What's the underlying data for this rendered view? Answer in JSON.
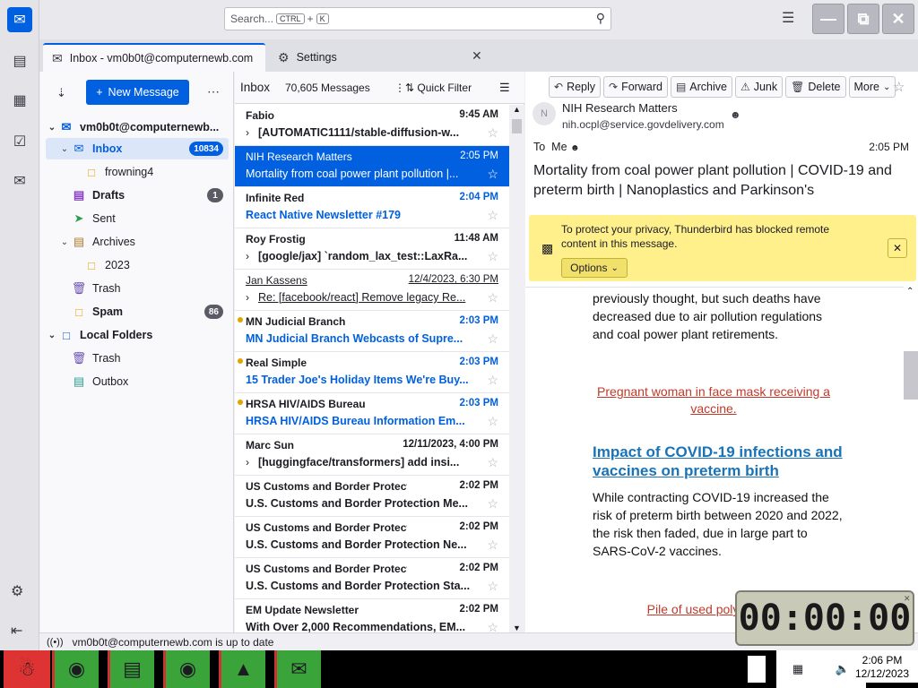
{
  "search": {
    "placeholder": "Search...",
    "key1": "CTRL",
    "plus": "+",
    "key2": "K"
  },
  "tabs": [
    {
      "label": "Inbox - vm0b0t@computernewb.com"
    },
    {
      "label": "Settings"
    }
  ],
  "folder_pane": {
    "new_message": "New Message",
    "folders": [
      {
        "label": "vm0b0t@computernewb...",
        "bold": true
      },
      {
        "label": "Inbox",
        "badge": "10834"
      },
      {
        "label": "frowning4"
      },
      {
        "label": "Drafts",
        "badge": "1"
      },
      {
        "label": "Sent"
      },
      {
        "label": "Archives"
      },
      {
        "label": "2023"
      },
      {
        "label": "Trash"
      },
      {
        "label": "Spam",
        "badge": "86"
      },
      {
        "label": "Local Folders"
      },
      {
        "label": "Trash"
      },
      {
        "label": "Outbox"
      }
    ]
  },
  "message_list": {
    "folder_name": "Inbox",
    "count": "70,605 Messages",
    "quick_filter": "Quick Filter",
    "messages": [
      {
        "from": "Fabio",
        "date": "9:45 AM",
        "subject": "[AUTOMATIC1111/stable-diffusion-w..."
      },
      {
        "from": "NIH Research Matters",
        "date": "2:05 PM",
        "subject": "Mortality from coal power plant pollution |..."
      },
      {
        "from": "Infinite Red",
        "date": "2:04 PM",
        "subject": "React Native Newsletter #179"
      },
      {
        "from": "Roy Frostig",
        "date": "11:48 AM",
        "subject": "[google/jax] `random_lax_test::LaxRa..."
      },
      {
        "from": "Jan Kassens",
        "date": "12/4/2023, 6:30 PM",
        "subject": "Re: [facebook/react] Remove legacy Re..."
      },
      {
        "from": "MN Judicial Branch",
        "date": "2:03 PM",
        "subject": "MN Judicial Branch Webcasts of Supre..."
      },
      {
        "from": "Real Simple",
        "date": "2:03 PM",
        "subject": "15 Trader Joe's Holiday Items We're Buy..."
      },
      {
        "from": "HRSA HIV/AIDS Bureau",
        "date": "2:03 PM",
        "subject": "HRSA HIV/AIDS Bureau Information Em..."
      },
      {
        "from": "Marc Sun",
        "date": "12/11/2023, 4:00 PM",
        "subject": "[huggingface/transformers] add insi..."
      },
      {
        "from": "US Customs and Border Protection",
        "date": "2:02 PM",
        "subject": "U.S. Customs and Border Protection Me..."
      },
      {
        "from": "US Customs and Border Protection",
        "date": "2:02 PM",
        "subject": "U.S. Customs and Border Protection Ne..."
      },
      {
        "from": "US Customs and Border Protection",
        "date": "2:02 PM",
        "subject": "U.S. Customs and Border Protection Sta..."
      },
      {
        "from": "EM Update Newsletter",
        "date": "2:02 PM",
        "subject": "With Over 2,000 Recommendations, EM..."
      }
    ]
  },
  "reader": {
    "toolbar": {
      "reply": "Reply",
      "forward": "Forward",
      "archive": "Archive",
      "junk": "Junk",
      "delete": "Delete",
      "more": "More"
    },
    "sender_initial": "N",
    "sender_name": "NIH Research Matters",
    "sender_email": "nih.ocpl@service.govdelivery.com",
    "to_label": "To",
    "to_value": "Me",
    "time": "2:05 PM",
    "subject": "Mortality from coal power plant pollution | COVID-19 and preterm birth | Nanoplastics and Parkinson's",
    "notice_text": "To protect your privacy, Thunderbird has blocked remote content in this message.",
    "notice_options": "Options",
    "body": {
      "p1": "previously thought, but such deaths have decreased due to air pollution regulations and coal power plant retirements.",
      "alt1": "Pregnant woman in face mask receiving a vaccine.",
      "h1": "Impact of COVID-19 infections and vaccines on preterm birth",
      "p2": "While contracting COVID-19 increased the risk of preterm birth between 2020 and 2022, the risk then faded, due in large part to SARS-CoV-2 vaccines.",
      "alt2": "Pile of used polystyrene"
    }
  },
  "status": {
    "text": "vm0b0t@computernewb.com is up to date"
  },
  "timer": {
    "value": "00:00:00"
  },
  "taskbar": {
    "time": "2:06 PM",
    "date": "12/12/2023"
  },
  "colors": {
    "accent": "#0060df",
    "notice": "#fff08c",
    "unread_dot": "#e3a300"
  }
}
